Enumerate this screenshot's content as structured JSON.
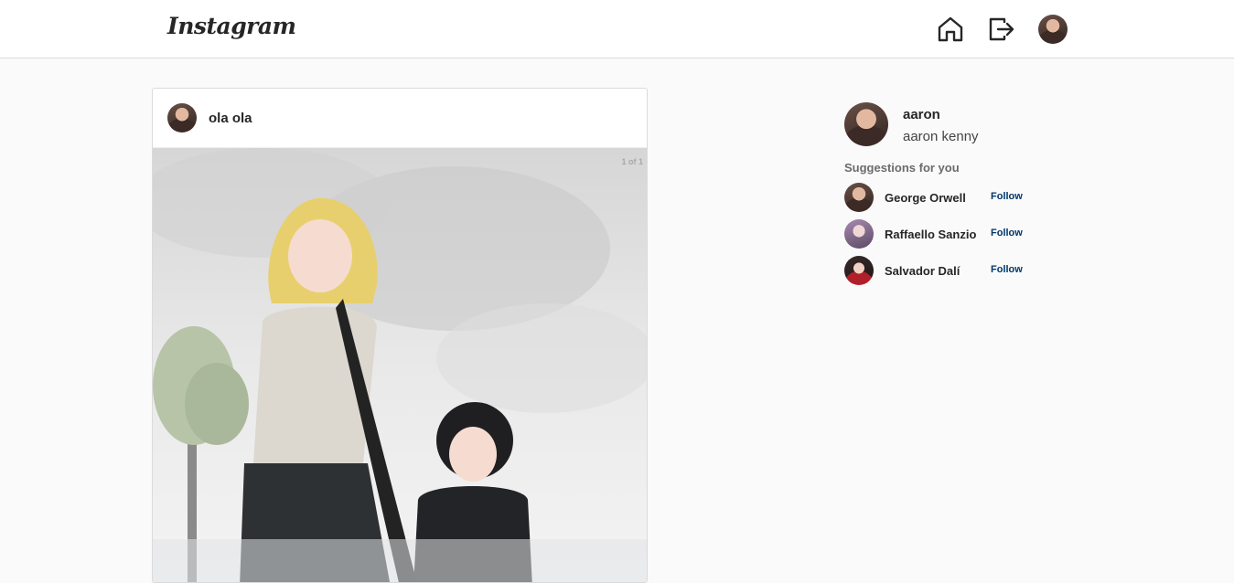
{
  "header": {
    "logo": "Instagram",
    "icons": [
      "home-icon",
      "logout-icon"
    ]
  },
  "post": {
    "username": "ola ola",
    "image_counter": "1 of 1"
  },
  "sidebar": {
    "username": "aaron",
    "full_name": "aaron kenny",
    "suggestions_title": "Suggestions for you",
    "suggestions": [
      {
        "name": "George Orwell",
        "action": "Follow"
      },
      {
        "name": "Raffaello Sanzio",
        "action": "Follow"
      },
      {
        "name": "Salvador Dalí",
        "action": "Follow"
      }
    ]
  },
  "colors": {
    "background": "#fafafa",
    "border": "#dbdbdb",
    "follow_link": "#00376b",
    "text": "#262626"
  }
}
